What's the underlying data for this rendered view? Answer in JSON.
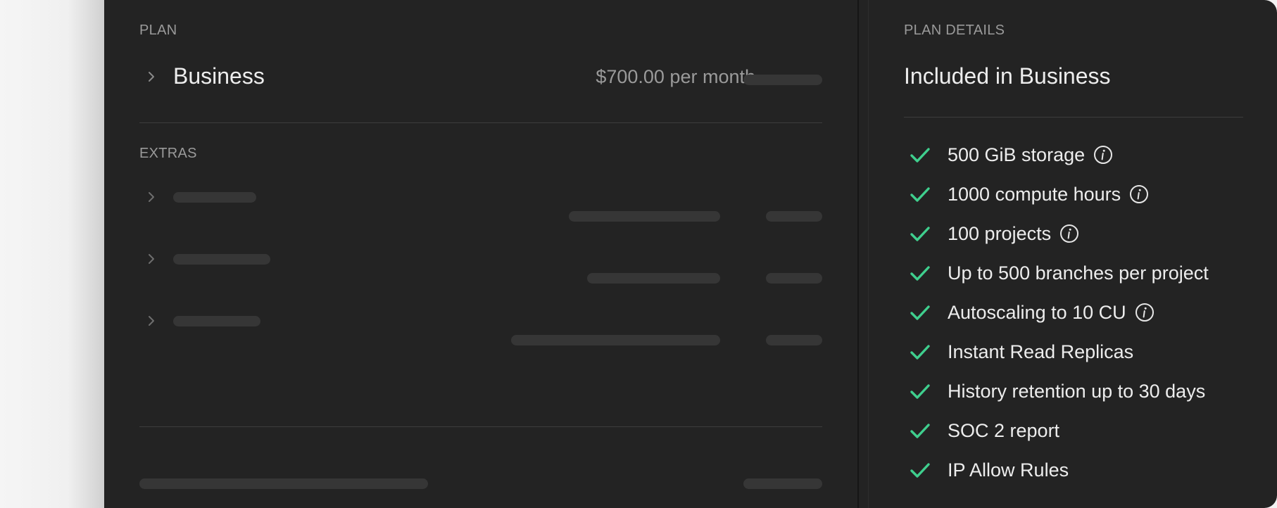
{
  "plan_section": {
    "label": "PLAN",
    "plan_name": "Business",
    "price": "$700.00 per month"
  },
  "extras_section": {
    "label": "EXTRAS"
  },
  "details_section": {
    "label": "PLAN DETAILS",
    "title": "Included in Business",
    "features": [
      {
        "text": "500 GiB storage",
        "info": true
      },
      {
        "text": "1000 compute hours",
        "info": true
      },
      {
        "text": "100 projects",
        "info": true
      },
      {
        "text": "Up to 500 branches per project",
        "info": false
      },
      {
        "text": "Autoscaling to 10 CU",
        "info": true
      },
      {
        "text": "Instant Read Replicas",
        "info": false
      },
      {
        "text": "History retention up to 30 days",
        "info": false
      },
      {
        "text": "SOC 2 report",
        "info": false
      },
      {
        "text": "IP Allow Rules",
        "info": false
      }
    ]
  },
  "colors": {
    "card_bg": "#232323",
    "check_green": "#3fcf8e",
    "muted_text": "#9a9a9a",
    "primary_text": "#ededed",
    "skeleton": "#363636"
  },
  "icons": {
    "expand": "chevron-right-icon",
    "check": "check-icon",
    "info": "info-icon"
  }
}
